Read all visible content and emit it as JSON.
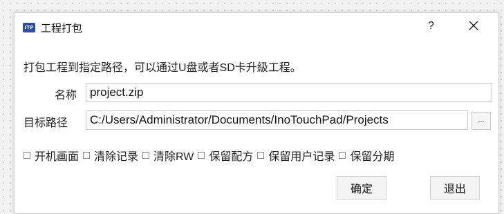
{
  "window": {
    "icon_text": "ITP",
    "title": "工程打包",
    "help_label": "?",
    "close_icon": "close-icon"
  },
  "description": "打包工程到指定路径，可以通过U盘或者SD卡升級工程。",
  "fields": {
    "name_label": "名称",
    "name_value": "project.zip",
    "path_label": "目标路径",
    "path_value": "C:/Users/Administrator/Documents/InoTouchPad/Projects",
    "browse_label": "..."
  },
  "options": [
    {
      "label": "开机画面",
      "checked": false
    },
    {
      "label": "清除记录",
      "checked": false
    },
    {
      "label": "清除RW",
      "checked": false
    },
    {
      "label": "保留配方",
      "checked": false
    },
    {
      "label": "保留用户记录",
      "checked": false
    },
    {
      "label": "保留分期",
      "checked": false
    }
  ],
  "buttons": {
    "ok": "确定",
    "exit": "退出"
  },
  "colors": {
    "icon_bg": "#2a4fb0",
    "dialog_bg": "#ffffff",
    "canvas_bg": "#f2f2f2"
  }
}
